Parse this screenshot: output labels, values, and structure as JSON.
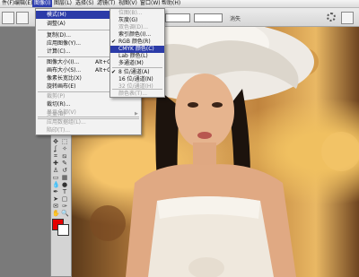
{
  "menubar": {
    "items": [
      "件(F)",
      "编辑(E)",
      "图像(I)",
      "图层(L)",
      "选择(S)",
      "滤镜(T)",
      "视图(V)",
      "窗口(W)",
      "帮助(H)"
    ]
  },
  "options_bar": {
    "field_label": "消失"
  },
  "image_menu": {
    "items": [
      {
        "label": "模式(M)",
        "shortcut": "",
        "submenu": true,
        "disabled": false,
        "highlighted": true
      },
      {
        "label": "调整(A)",
        "shortcut": "",
        "submenu": true,
        "disabled": false,
        "highlighted": false
      },
      {
        "label": "复制(D)...",
        "shortcut": "",
        "submenu": false,
        "disabled": false,
        "highlighted": false
      },
      {
        "label": "应用图像(Y)...",
        "shortcut": "",
        "submenu": false,
        "disabled": false,
        "highlighted": false
      },
      {
        "label": "计算(C)...",
        "shortcut": "",
        "submenu": false,
        "disabled": false,
        "highlighted": false
      },
      {
        "label": "图像大小(I)...",
        "shortcut": "Alt+Ctrl+I",
        "submenu": false,
        "disabled": false,
        "highlighted": false
      },
      {
        "label": "画布大小(S)...",
        "shortcut": "Alt+Ctrl+C",
        "submenu": false,
        "disabled": false,
        "highlighted": false
      },
      {
        "label": "像素长宽比(X)",
        "shortcut": "",
        "submenu": true,
        "disabled": false,
        "highlighted": false
      },
      {
        "label": "旋转画布(E)",
        "shortcut": "",
        "submenu": true,
        "disabled": false,
        "highlighted": false
      },
      {
        "label": "裁剪(P)",
        "shortcut": "",
        "submenu": false,
        "disabled": true,
        "highlighted": false
      },
      {
        "label": "裁切(R)...",
        "shortcut": "",
        "submenu": false,
        "disabled": false,
        "highlighted": false
      },
      {
        "label": "显示全部(V)",
        "shortcut": "",
        "submenu": false,
        "disabled": true,
        "highlighted": false
      },
      {
        "label": "变量(B)",
        "shortcut": "",
        "submenu": true,
        "disabled": true,
        "highlighted": false
      },
      {
        "label": "应用数据组(L)...",
        "shortcut": "",
        "submenu": false,
        "disabled": true,
        "highlighted": false
      },
      {
        "label": "陷印(T)...",
        "shortcut": "",
        "submenu": false,
        "disabled": true,
        "highlighted": false
      }
    ]
  },
  "mode_submenu": {
    "items": [
      {
        "label": "位图(B)...",
        "disabled": true,
        "checked": false,
        "highlighted": false
      },
      {
        "label": "灰度(G)",
        "disabled": false,
        "checked": false,
        "highlighted": false
      },
      {
        "label": "双色调(D)...",
        "disabled": true,
        "checked": false,
        "highlighted": false
      },
      {
        "label": "索引颜色(I)...",
        "disabled": false,
        "checked": false,
        "highlighted": false
      },
      {
        "label": "RGB 颜色(R)",
        "disabled": false,
        "checked": true,
        "highlighted": false
      },
      {
        "label": "CMYK 颜色(C)",
        "disabled": false,
        "checked": false,
        "highlighted": true
      },
      {
        "label": "Lab 颜色(L)",
        "disabled": false,
        "checked": false,
        "highlighted": false
      },
      {
        "label": "多通道(M)",
        "disabled": false,
        "checked": false,
        "highlighted": false
      },
      {
        "label": "8 位/通道(A)",
        "disabled": false,
        "checked": true,
        "highlighted": false
      },
      {
        "label": "16 位/通道(N)",
        "disabled": false,
        "checked": false,
        "highlighted": false
      },
      {
        "label": "32 位/通道(H)",
        "disabled": true,
        "checked": false,
        "highlighted": false
      },
      {
        "label": "颜色表(T)...",
        "disabled": true,
        "checked": false,
        "highlighted": false
      }
    ]
  },
  "tool_icons": [
    "move-tool-icon",
    "marquee-tool-icon",
    "lasso-tool-icon",
    "magic-wand-icon",
    "crop-tool-icon",
    "slice-tool-icon",
    "healing-brush-icon",
    "brush-tool-icon",
    "stamp-tool-icon",
    "history-brush-icon",
    "eraser-tool-icon",
    "gradient-tool-icon",
    "blur-tool-icon",
    "dodge-tool-icon",
    "pen-tool-icon",
    "type-tool-icon",
    "path-select-icon",
    "shape-tool-icon",
    "notes-tool-icon",
    "eyedropper-icon",
    "hand-tool-icon",
    "zoom-tool-icon"
  ],
  "tool_glyphs": [
    "✥",
    "⬚",
    "ʆ",
    "✧",
    "⌗",
    "⧅",
    "✚",
    "✎",
    "♙",
    "↺",
    "▭",
    "▦",
    "💧",
    "●",
    "✒",
    "T",
    "➤",
    "▢",
    "✉",
    "✑",
    "✋",
    "🔍"
  ],
  "colors": {
    "foreground": "#e50000",
    "background": "#ffffff",
    "menu_highlight": "#2b3ba8"
  }
}
